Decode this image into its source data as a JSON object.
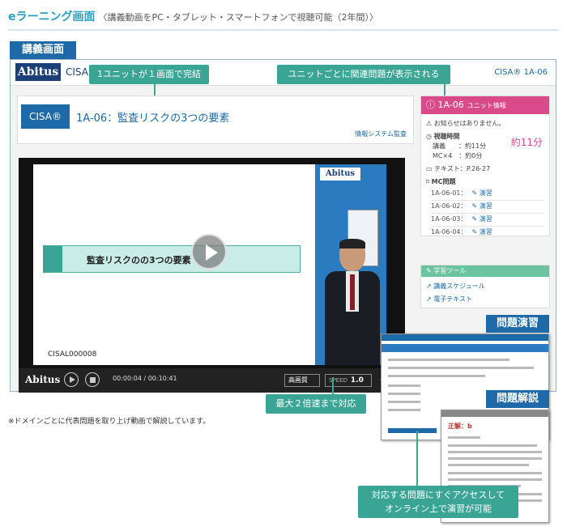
{
  "page": {
    "title": "eラーニング画面",
    "subtitle": "〈講義動画をPC・タブレット・スマートフォンで視聴可能（2年間）〉",
    "section_label": "講義画面",
    "note": "※ドメインごとに代表問題を取り上げ動画で解説しています。"
  },
  "app": {
    "logo": "Abitus",
    "course_code": "CISAL",
    "header_right": "CISA® 1A-06",
    "badge": "CISA®",
    "lesson_title": "1A-06：監査リスクの3つの要素",
    "lesson_category": "情報システム監査"
  },
  "video": {
    "slide_topic": "監査リスクのの3つの要素",
    "slide_id": "CISAL000008",
    "slide_logo": "Abitus",
    "controls_logo": "Abitus",
    "time": "00:00:04 / 00:10:41",
    "quality": "高画質",
    "speed_label": "SPEED",
    "speed_value": "1.0"
  },
  "unit_info": {
    "heading": "1A-06",
    "heading_sub": "ユニット情報",
    "notice": "お知らせはありません。",
    "viewing_label": "視聴時間",
    "lecture": "講義　　：約11分",
    "mc": "MC×4　：約0分",
    "duration": "約11分",
    "text": "テキスト：P.26-27",
    "mc_label": "MC問題",
    "mc_items": [
      {
        "id": "1A-06-01：",
        "link": "演習"
      },
      {
        "id": "1A-06-02：",
        "link": "演習"
      },
      {
        "id": "1A-06-03：",
        "link": "演習"
      },
      {
        "id": "1A-06-04：",
        "link": "演習"
      }
    ]
  },
  "tools": {
    "heading": "学習ツール",
    "schedule": "講義スケジュール",
    "ebook": "電子テキスト"
  },
  "callouts": {
    "one_unit": "1ユニットが１画面で完結",
    "related": "ユニットごとに関連問題が表示される",
    "speed": "最大２倍速まで対応",
    "access_line1": "対応する問題にすぐアクセスして",
    "access_line2": "オンライン上で演習が可能"
  },
  "tags": {
    "practice": "問題演習",
    "explanation": "問題解説"
  },
  "shots": {
    "answer": "正解：b"
  },
  "colors": {
    "accent_blue": "#1e6aa8",
    "teal": "#3ba595",
    "pink": "#d94a8a",
    "green": "#6cc3a0"
  }
}
